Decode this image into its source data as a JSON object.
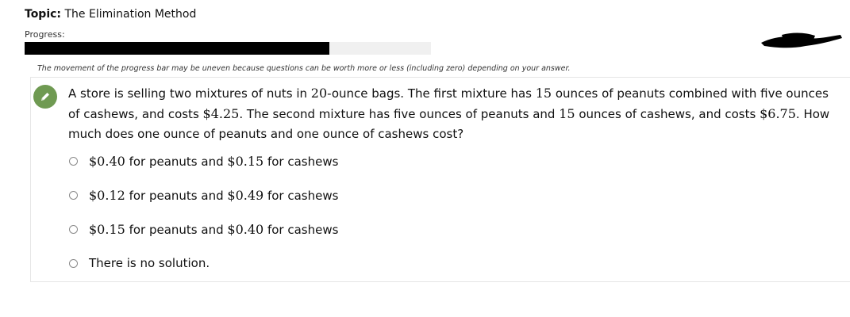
{
  "header": {
    "topic_label": "Topic:",
    "topic_value": "The Elimination Method",
    "progress_label": "Progress:",
    "progress_fraction": 0.75,
    "note": "The movement of the progress bar may be uneven because questions can be worth more or less (including zero) depending on your answer."
  },
  "question": {
    "p1": "A store is selling two mixtures of nuts in ",
    "m1": "20",
    "p2": "-ounce bags. The first mixture has ",
    "m2": "15",
    "p3": " ounces of peanuts combined with five ounces of cashews, and costs ",
    "m3": "$4.25",
    "p4": ". The second mixture has five ounces of peanuts and ",
    "m4": "15",
    "p5": " ounces of cashews, and costs ",
    "m5": "$6.75",
    "p6": ". How much does one ounce of peanuts and one ounce of cashews cost?"
  },
  "options": [
    {
      "a": "$0.40",
      "b": " for peanuts and ",
      "c": "$0.15",
      "d": " for cashews"
    },
    {
      "a": "$0.12",
      "b": " for peanuts and ",
      "c": "$0.49",
      "d": " for cashews"
    },
    {
      "a": "$0.15",
      "b": " for peanuts and ",
      "c": "$0.40",
      "d": " for cashews"
    },
    {
      "text": "There is no solution."
    }
  ],
  "icons": {
    "question_status": "pencil-icon"
  },
  "colors": {
    "accent": "#6f9a52",
    "progress_fill": "#000000",
    "progress_track": "#f0f0f0"
  }
}
